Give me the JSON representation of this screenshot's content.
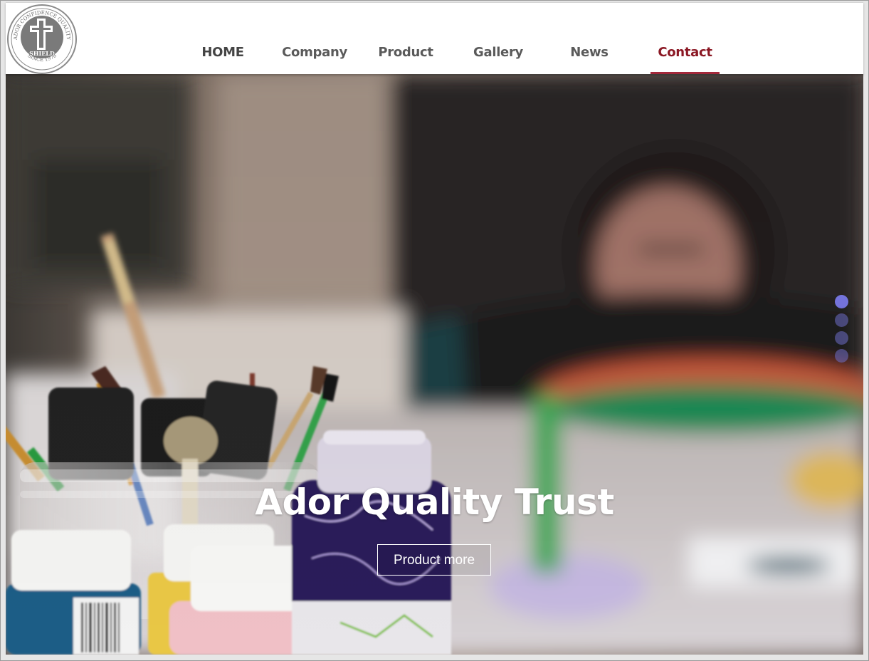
{
  "logo": {
    "text_top": "ADOR CONFIDENCE QUALITY",
    "text_mid": "SHIELD",
    "text_bottom": "SINCE 1978"
  },
  "nav": {
    "items": [
      {
        "label": "HOME",
        "active": false
      },
      {
        "label": "Company",
        "active": false
      },
      {
        "label": "Product",
        "active": false
      },
      {
        "label": "Gallery",
        "active": false
      },
      {
        "label": "News",
        "active": false
      },
      {
        "label": "Contact",
        "active": true
      }
    ]
  },
  "hero": {
    "title": "Ador Quality Trust",
    "button_label": "Product more",
    "slide_count": 4,
    "active_slide": 1
  },
  "colors": {
    "active_nav": "#8b1824",
    "nav_text": "#5a5a5a",
    "slider_dot": "#7878e6"
  }
}
